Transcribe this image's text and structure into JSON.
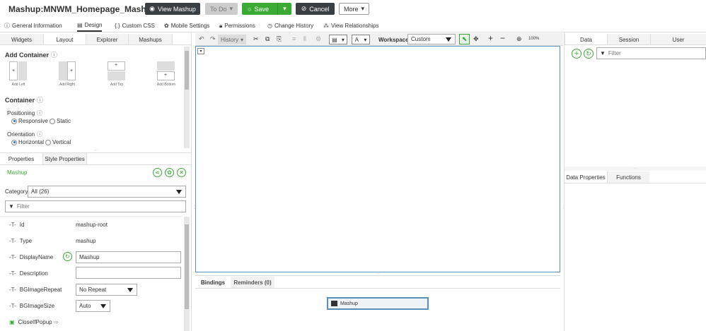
{
  "header": {
    "title": "Mashup:MNWM_Homepage_Mashup",
    "view_mashup": "View Mashup",
    "todo": "To Do",
    "save": "Save",
    "cancel": "Cancel",
    "more": "More"
  },
  "top_tabs": [
    "General Information",
    "Design",
    "Custom CSS",
    "Mobile Settings",
    "Permissions",
    "Change History",
    "View Relationships"
  ],
  "left": {
    "tabs": [
      "Widgets",
      "Layout",
      "Explorer",
      "Mashups"
    ],
    "add_container": "Add Container",
    "add_labels": [
      "Add Left",
      "Add Right",
      "Add Top",
      "Add Bottom"
    ],
    "container": "Container",
    "positioning": "Positioning",
    "responsive": "Responsive",
    "static": "Static",
    "orientation": "Orientation",
    "horizontal": "Horizontal",
    "vertical": "Vertical"
  },
  "props": {
    "tabs": [
      "Properties",
      "Style Properties"
    ],
    "entity": "Mashup",
    "category_label": "Category",
    "category_value": "All (26)",
    "filter_placeholder": "Filter",
    "rows": [
      {
        "name": "Id",
        "value": "mashup-root"
      },
      {
        "name": "Type",
        "value": "mashup"
      },
      {
        "name": "DisplayName",
        "value": "Mashup"
      },
      {
        "name": "Description",
        "value": ""
      },
      {
        "name": "BGImageRepeat",
        "value": "No Repeat"
      },
      {
        "name": "BGImageSize",
        "value": "Auto"
      },
      {
        "name": "CloseIfPopup",
        "value": ""
      }
    ]
  },
  "toolbar": {
    "history": "History",
    "workspace_label": "Workspace",
    "workspace_value": "Custom",
    "zoom": "100%"
  },
  "bindings": {
    "tabs": [
      "Bindings",
      "Reminders (0)"
    ],
    "node": "Mashup"
  },
  "right": {
    "tabs": [
      "Data",
      "Session",
      "User"
    ],
    "filter_placeholder": "Filter",
    "bottom_tabs": [
      "Data Properties",
      "Functions"
    ]
  }
}
